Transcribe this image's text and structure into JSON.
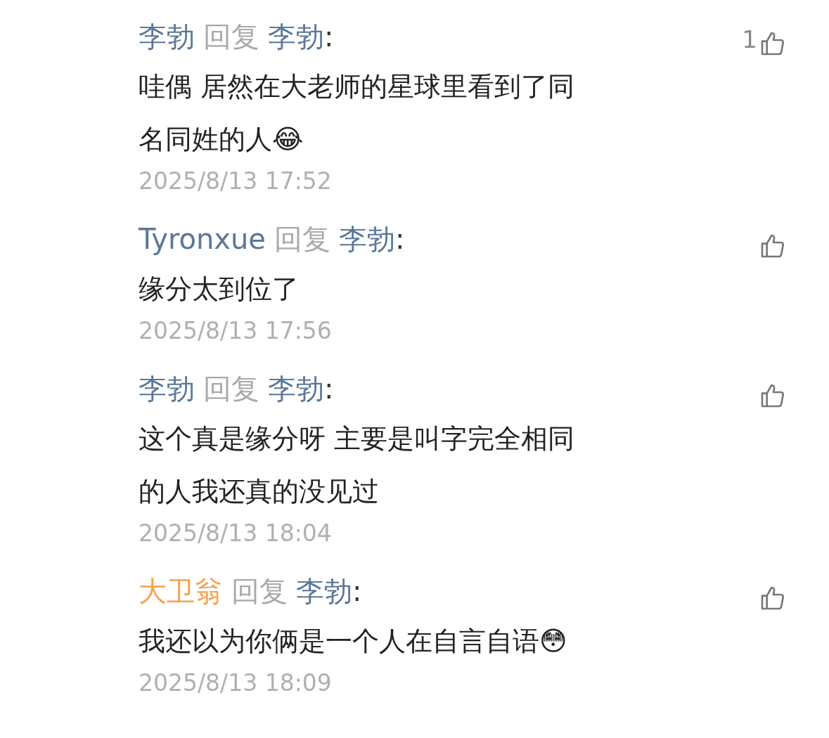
{
  "comments": [
    {
      "author": {
        "name": "李勃",
        "color": "#5b7897"
      },
      "reply_word": "回复",
      "reply_to": "李勃",
      "colon": ":",
      "lines": [
        "哇偶 居然在大老师的星球里看到了同",
        "名同姓的人😂"
      ],
      "time": "2025/8/13 17:52",
      "likes": "1"
    },
    {
      "author": {
        "name": "Tyronxue",
        "color": "#5b7897"
      },
      "reply_word": "回复",
      "reply_to": "李勃",
      "colon": ":",
      "lines": [
        "缘分太到位了"
      ],
      "time": "2025/8/13 17:56"
    },
    {
      "author": {
        "name": "李勃",
        "color": "#5b7897"
      },
      "reply_word": "回复",
      "reply_to": "李勃",
      "colon": ":",
      "lines": [
        "这个真是缘分呀 主要是叫字完全相同",
        "的人我还真的没见过"
      ],
      "time": "2025/8/13 18:04"
    },
    {
      "author": {
        "name": "大卫翁",
        "color": "#f4a352"
      },
      "reply_word": "回复",
      "reply_to": "李勃",
      "colon": ":",
      "lines": [
        "我还以为你俩是一个人在自言自语😳"
      ],
      "time": "2025/8/13 18:09"
    }
  ]
}
